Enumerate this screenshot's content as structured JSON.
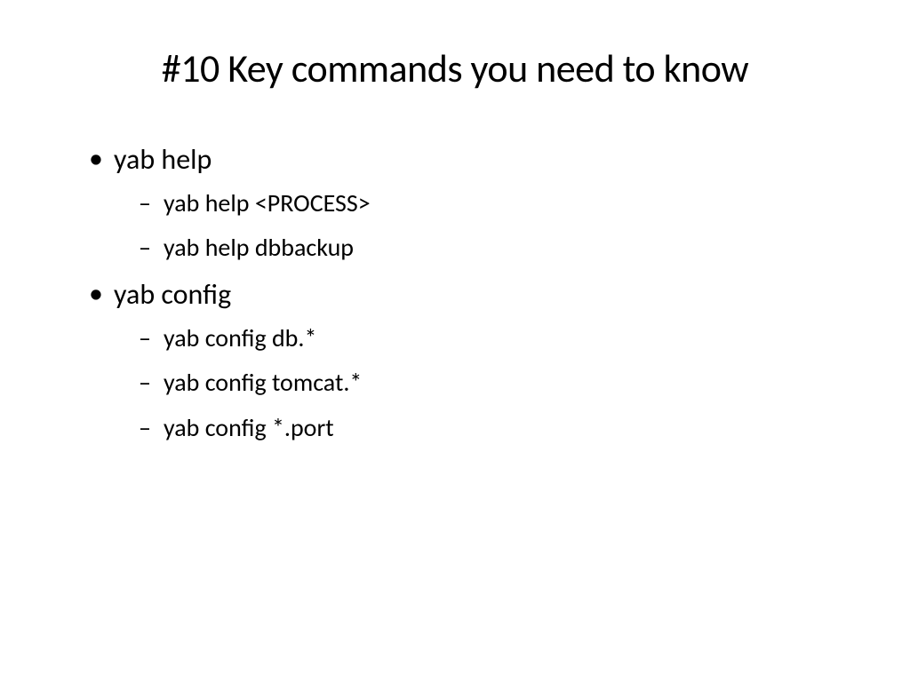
{
  "title": "#10 Key commands you need to know",
  "bullets": [
    {
      "label": "yab help",
      "sub": [
        {
          "label": "yab help <PROCESS>"
        },
        {
          "label": "yab help dbbackup"
        }
      ]
    },
    {
      "label": "yab config",
      "sub": [
        {
          "label": "yab config db.*"
        },
        {
          "label": "yab config tomcat.*"
        },
        {
          "label": "yab config *.port"
        }
      ]
    }
  ]
}
